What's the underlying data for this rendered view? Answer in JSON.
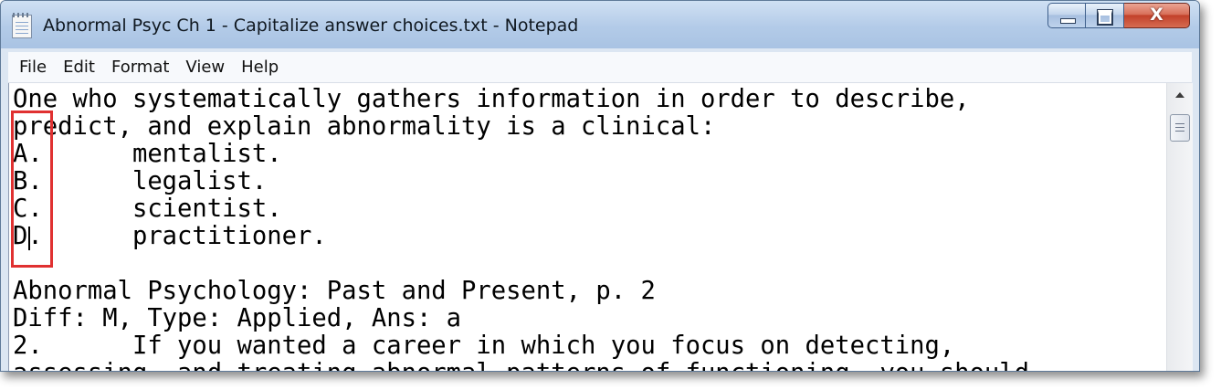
{
  "window": {
    "title": "Abnormal Psyc Ch 1 - Capitalize answer choices.txt - Notepad",
    "icon": "notepad-icon",
    "controls": {
      "minimize": "minimize-icon",
      "maximize": "maximize-icon",
      "close": "close-icon",
      "close_glyph": "X"
    }
  },
  "menu": {
    "items": [
      {
        "label": "File"
      },
      {
        "label": "Edit"
      },
      {
        "label": "Format"
      },
      {
        "label": "View"
      },
      {
        "label": "Help"
      }
    ]
  },
  "document": {
    "lines": [
      "One who systematically gathers information in order to describe,",
      "predict, and explain abnormality is a clinical:",
      "A.\tmentalist.",
      "B.\tlegalist.",
      "C.\tscientist.",
      "D.\tpractitioner.",
      "",
      "Abnormal Psychology: Past and Present, p. 2",
      "Diff: M, Type: Applied, Ans: a",
      "2.\tIf you wanted a career in which you focus on detecting,",
      "assessing, and treating abnormal patterns of functioning, you should"
    ]
  },
  "annotation": {
    "highlight_color": "#e03131"
  },
  "colors": {
    "titlebar": "#b3cbe8",
    "close_button": "#c2412a",
    "editor_background": "#ffffff"
  }
}
